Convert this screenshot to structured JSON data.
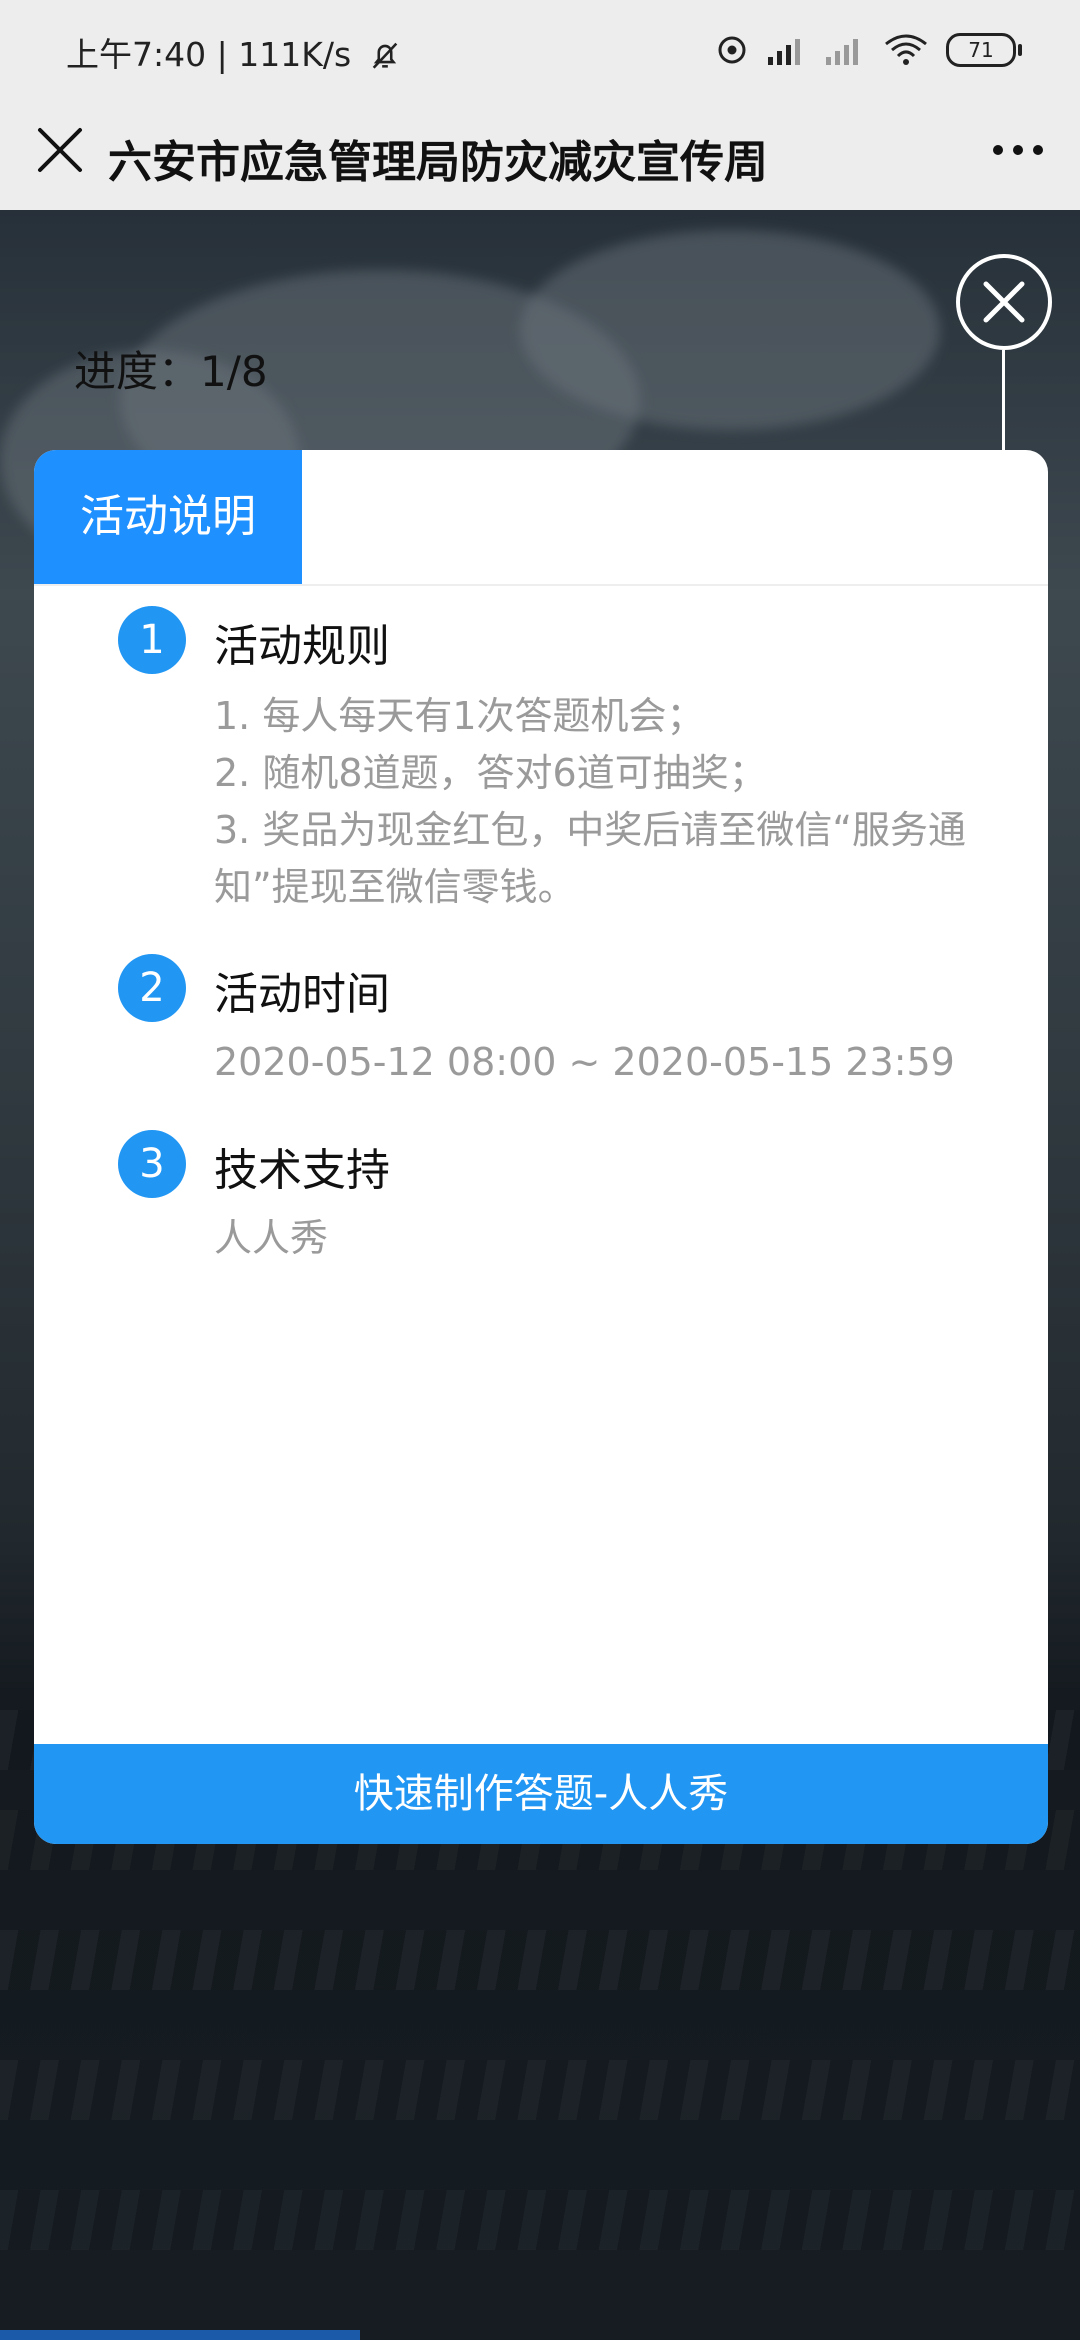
{
  "status_bar": {
    "time_speed": "上午7:40 | 111K/s",
    "battery": "71"
  },
  "title_bar": {
    "title": "六安市应急管理局防灾减灾宣传周"
  },
  "quiz": {
    "progress": "进度：1/8"
  },
  "modal": {
    "tab_label": "活动说明",
    "sections": [
      {
        "number": "1",
        "title": "活动规则",
        "lines": [
          "1. 每人每天有1次答题机会；",
          "2. 随机8道题，答对6道可抽奖；",
          "3. 奖品为现金红包，中奖后请至微信“服务通知”提现至微信零钱。"
        ]
      },
      {
        "number": "2",
        "title": "活动时间",
        "text": "2020-05-12 08:00 ~ 2020-05-15 23:59"
      },
      {
        "number": "3",
        "title": "技术支持",
        "text": "人人秀"
      }
    ],
    "footer_button": "快速制作答题-人人秀"
  },
  "icons": {
    "close": "close-icon",
    "more": "more-icon",
    "mute": "bell-off-icon",
    "signal": "signal-icon",
    "wifi": "wifi-icon"
  },
  "colors": {
    "accent": "#2196f3",
    "tab_blue": "#1e90ff"
  }
}
